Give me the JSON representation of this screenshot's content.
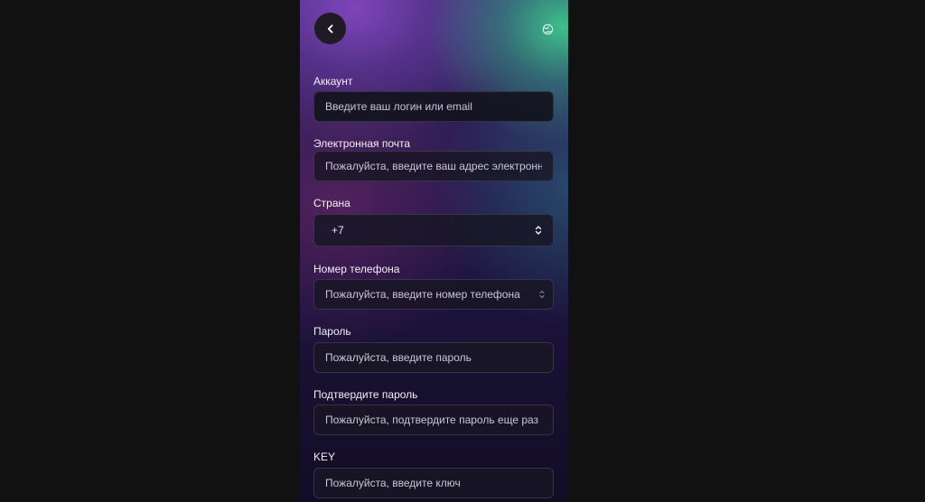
{
  "form": {
    "account": {
      "label": "Аккаунт",
      "placeholder": "Введите ваш логин или email"
    },
    "email": {
      "label": "Электронная почта",
      "placeholder": "Пожалуйста, введите ваш адрес электронной почты"
    },
    "country": {
      "label": "Страна",
      "value": "+7"
    },
    "phone": {
      "label": "Номер телефона",
      "placeholder": "Пожалуйста, введите номер телефона"
    },
    "password": {
      "label": "Пароль",
      "placeholder": "Пожалуйста, введите пароль"
    },
    "confirm": {
      "label": "Подтвердите пароль",
      "placeholder": "Пожалуйста, подтвердите пароль еще раз"
    },
    "key": {
      "label": "KEY",
      "placeholder": "Пожалуйста, введите ключ"
    }
  },
  "icons": {
    "back": "chevron-left-icon",
    "language": "globe-icon",
    "select": "chevron-up-down-icon"
  },
  "colors": {
    "page_bg": "#111111",
    "field_bg": "#181624",
    "text": "#f2f0f5",
    "accent_green": "#3cc88c",
    "accent_purple": "#8246be"
  }
}
